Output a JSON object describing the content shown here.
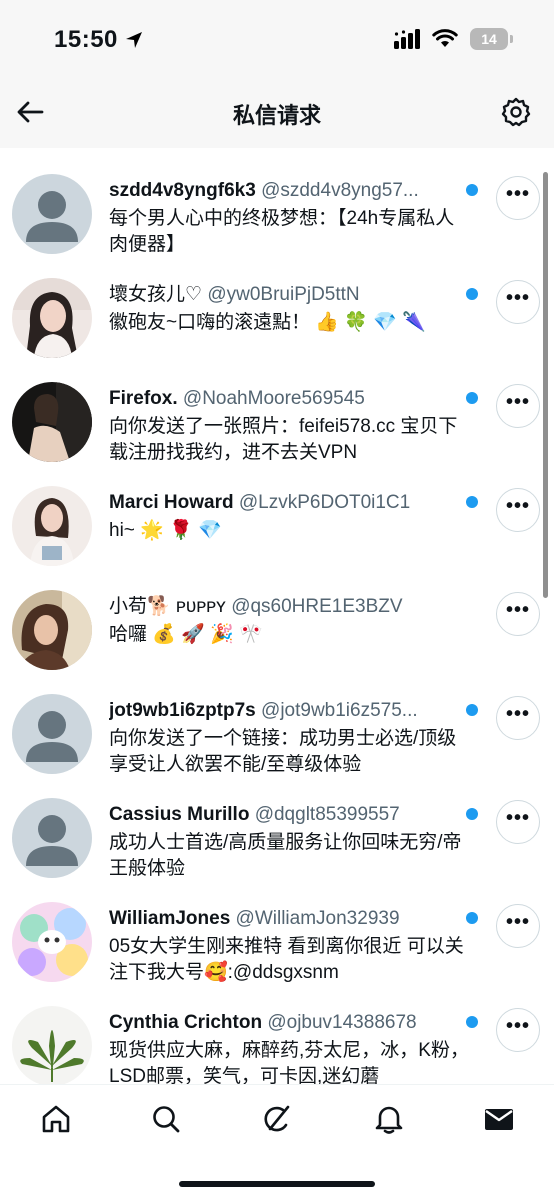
{
  "status_bar": {
    "time": "15:50",
    "battery": "14"
  },
  "header": {
    "title": "私信请求"
  },
  "conversations": [
    {
      "name": "szdd4v8yngf6k3",
      "handle": "@szdd4v8yng57...",
      "preview": "每个男人心中的终极梦想：【24h专属私人肉便器】",
      "unread": true,
      "avatar": "default-avatar"
    },
    {
      "name": "壞女孩儿♡",
      "handle": "@yw0BruiPjD5ttN",
      "preview": "徽砲友~口嗨的滚遠點！ 👍 🍀 💎 🌂",
      "unread": true,
      "avatar": "photo-avatar"
    },
    {
      "name": "Firefox.",
      "handle": "@NoahMoore569545",
      "preview": "向你发送了一张照片：feifei578.cc 宝贝下载注册找我约，进不去关VPN",
      "unread": true,
      "avatar": "photo-avatar"
    },
    {
      "name": "Marci Howard",
      "handle": "@LzvkP6DOT0i1C1",
      "preview": "hi~ 🌟 🌹 💎",
      "unread": true,
      "avatar": "photo-avatar"
    },
    {
      "name": "小苟🐕 ᴘᴜᴘᴘʏ",
      "handle": "@qs60HRE1E3BZV",
      "preview": "哈囉 💰 🚀 🎉 🎌",
      "unread": false,
      "avatar": "photo-avatar"
    },
    {
      "name": "jot9wb1i6zptp7s",
      "handle": "@jot9wb1i6z575...",
      "preview": "向你发送了一个链接：成功男士必选/顶级享受让人欲罢不能/至尊级体验",
      "unread": true,
      "avatar": "default-avatar"
    },
    {
      "name": "Cassius Murillo",
      "handle": "@dqglt85399557",
      "preview": "成功人士首选/高质量服务让你回味无穷/帝王般体验",
      "unread": true,
      "avatar": "default-avatar"
    },
    {
      "name": "WilliamJones",
      "handle": "@WilliamJon32939",
      "preview": "05女大学生刚来推特 看到离你很近 可以关注下我大号🥰:@ddsgxsnm",
      "unread": true,
      "avatar": "illustration-avatar"
    },
    {
      "name": "Cynthia Crichton",
      "handle": "@ojbuv14388678",
      "preview": "现货供应大麻，麻醉药,芬太尼，冰，K粉，LSD邮票，笑气，可卡因,迷幻蘑",
      "unread": true,
      "avatar": "leaf-avatar"
    }
  ],
  "more_button_label": "•••",
  "tabs": [
    {
      "name": "home",
      "icon": "home-icon"
    },
    {
      "name": "search",
      "icon": "search-icon"
    },
    {
      "name": "grok",
      "icon": "grok-icon"
    },
    {
      "name": "notifications",
      "icon": "bell-icon"
    },
    {
      "name": "messages",
      "icon": "envelope-icon"
    }
  ],
  "colors": {
    "accent": "#1d9bf0",
    "text": "#0f1419",
    "secondary": "#536471"
  }
}
